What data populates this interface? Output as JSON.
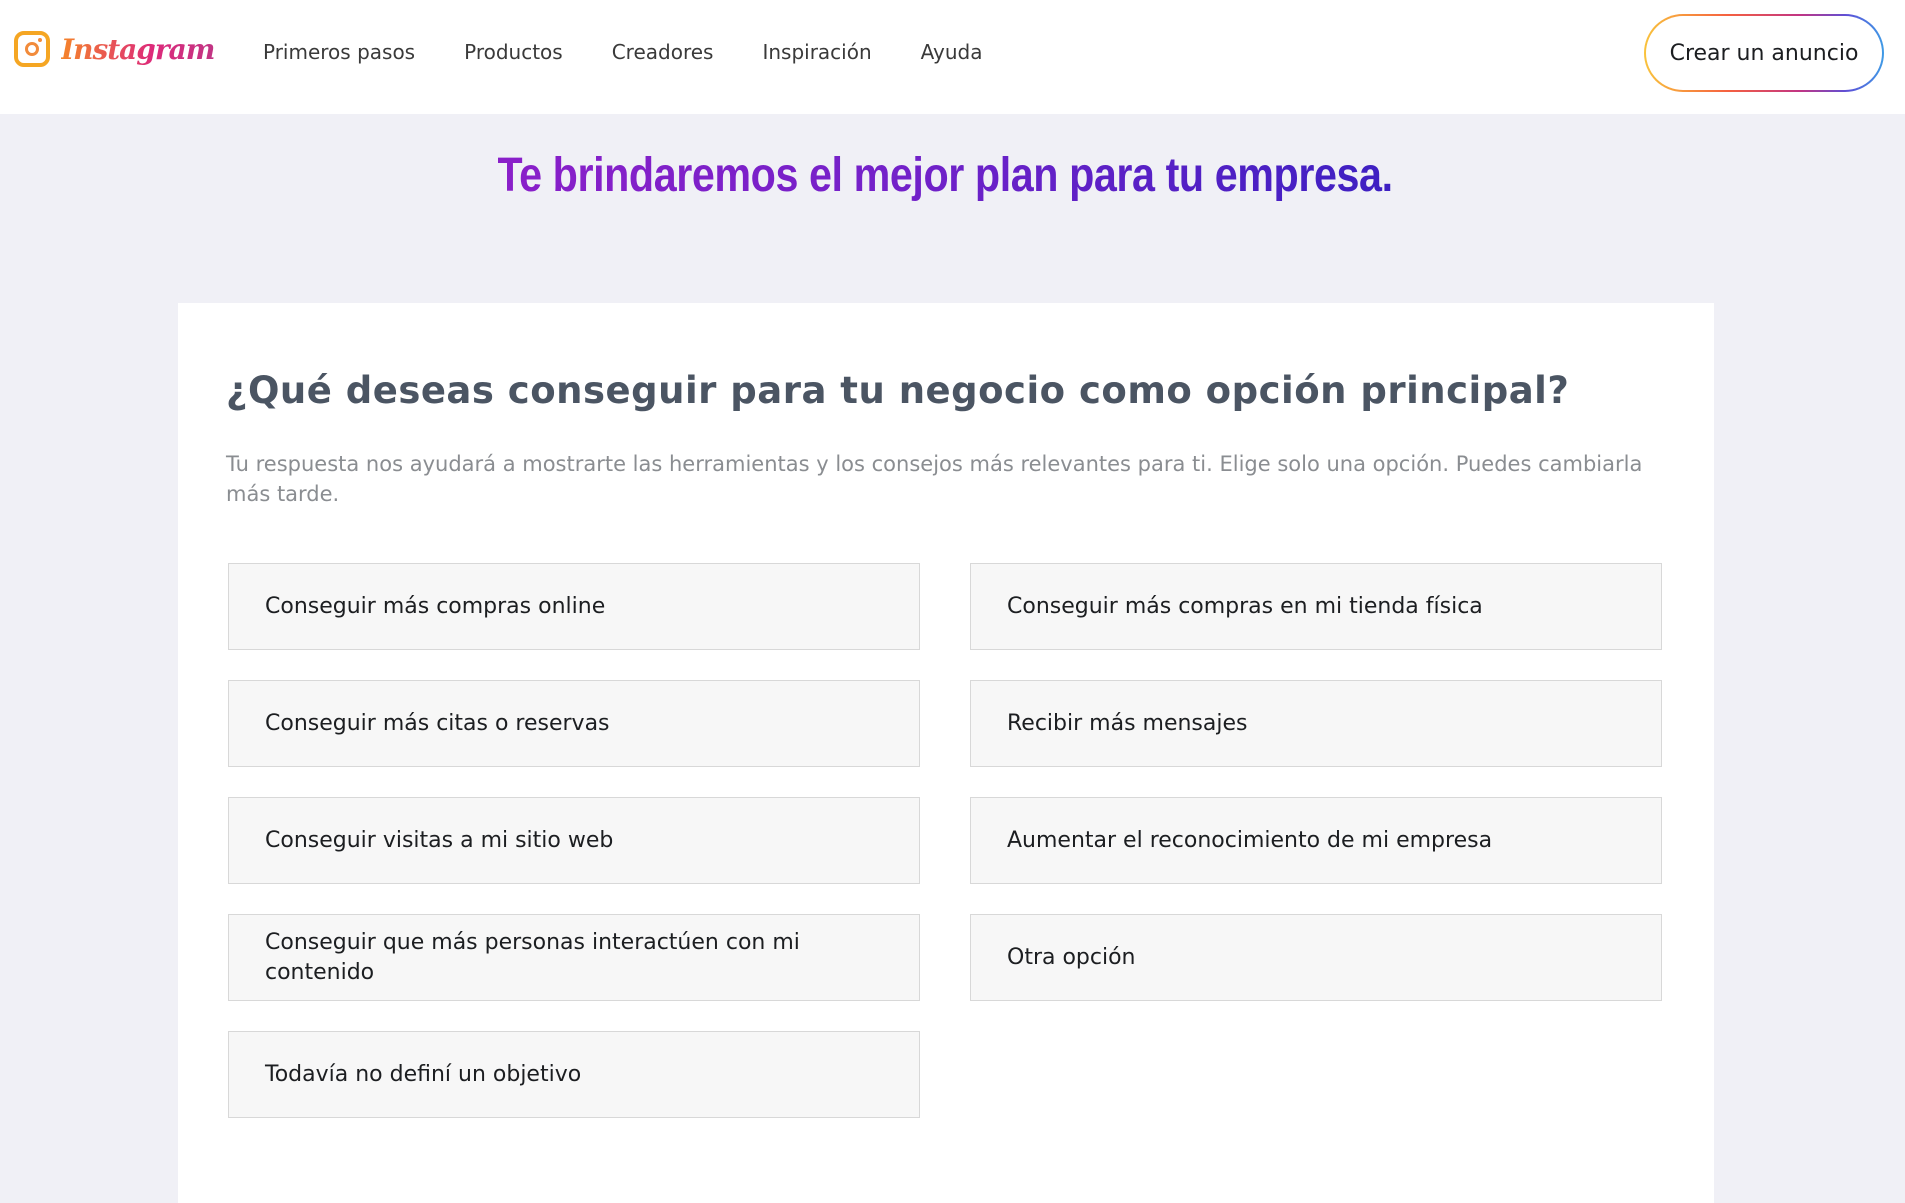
{
  "header": {
    "logo_text": "Instagram",
    "nav": [
      "Primeros pasos",
      "Productos",
      "Creadores",
      "Inspiración",
      "Ayuda"
    ],
    "cta_label": "Crear un anuncio"
  },
  "hero": {
    "title": "Te brindaremos el mejor plan para tu empresa."
  },
  "card": {
    "question": "¿Qué deseas conseguir para tu negocio como opción principal?",
    "description": "Tu respuesta nos ayudará a mostrarte las herramientas y los consejos más relevantes para ti. Elige solo una opción. Puedes cambiarla más tarde.",
    "options": [
      "Conseguir más compras online",
      "Conseguir más compras en mi tienda física",
      "Conseguir más citas o reservas",
      "Recibir más mensajes",
      "Conseguir visitas a mi sitio web",
      "Aumentar el reconocimiento de mi empresa",
      "Conseguir que más personas interactúen con mi contenido",
      "Otra opción",
      "Todavía no definí un objetivo"
    ]
  },
  "colors": {
    "page_bg": "#f0f0f6",
    "header_bg": "#ffffff",
    "option_bg": "#f7f7f7",
    "title_gradient_start": "#8a1fc9",
    "title_gradient_end": "#3d20c2"
  },
  "icons": {
    "logo": "instagram-glyph-icon"
  }
}
